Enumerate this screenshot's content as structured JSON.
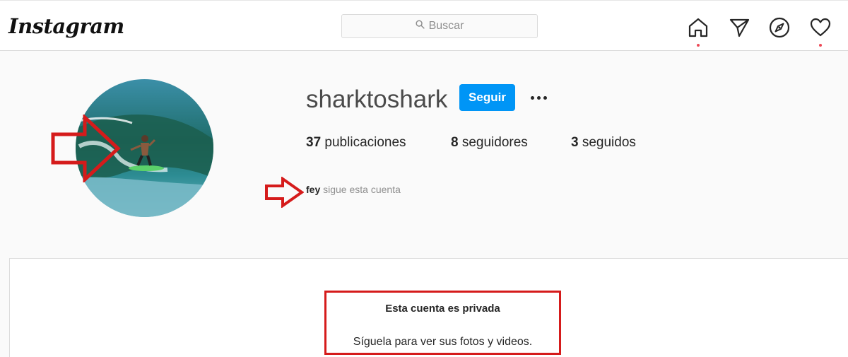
{
  "app": {
    "logo_text": "Instagram"
  },
  "search": {
    "placeholder": "Buscar",
    "icon": "search-icon"
  },
  "nav": {
    "icons": [
      "home-icon",
      "direct-send-icon",
      "explore-compass-icon",
      "activity-heart-icon"
    ],
    "notification_dot_color": "#ed4956"
  },
  "profile": {
    "username": "sharktoshark",
    "follow_label": "Seguir",
    "more_icon": "more-options-icon",
    "stats": {
      "posts_count": "37",
      "posts_label": "publicaciones",
      "followers_count": "8",
      "followers_label": "seguidores",
      "following_count": "3",
      "following_label": "seguidos"
    },
    "followed_by_user": "fey",
    "followed_by_text": "sigue esta cuenta"
  },
  "private_notice": {
    "title": "Esta cuenta es privada",
    "subtitle": "Síguela para ver sus fotos y videos."
  },
  "colors": {
    "accent": "#0095f6",
    "annotation_red": "#d51b1b"
  }
}
